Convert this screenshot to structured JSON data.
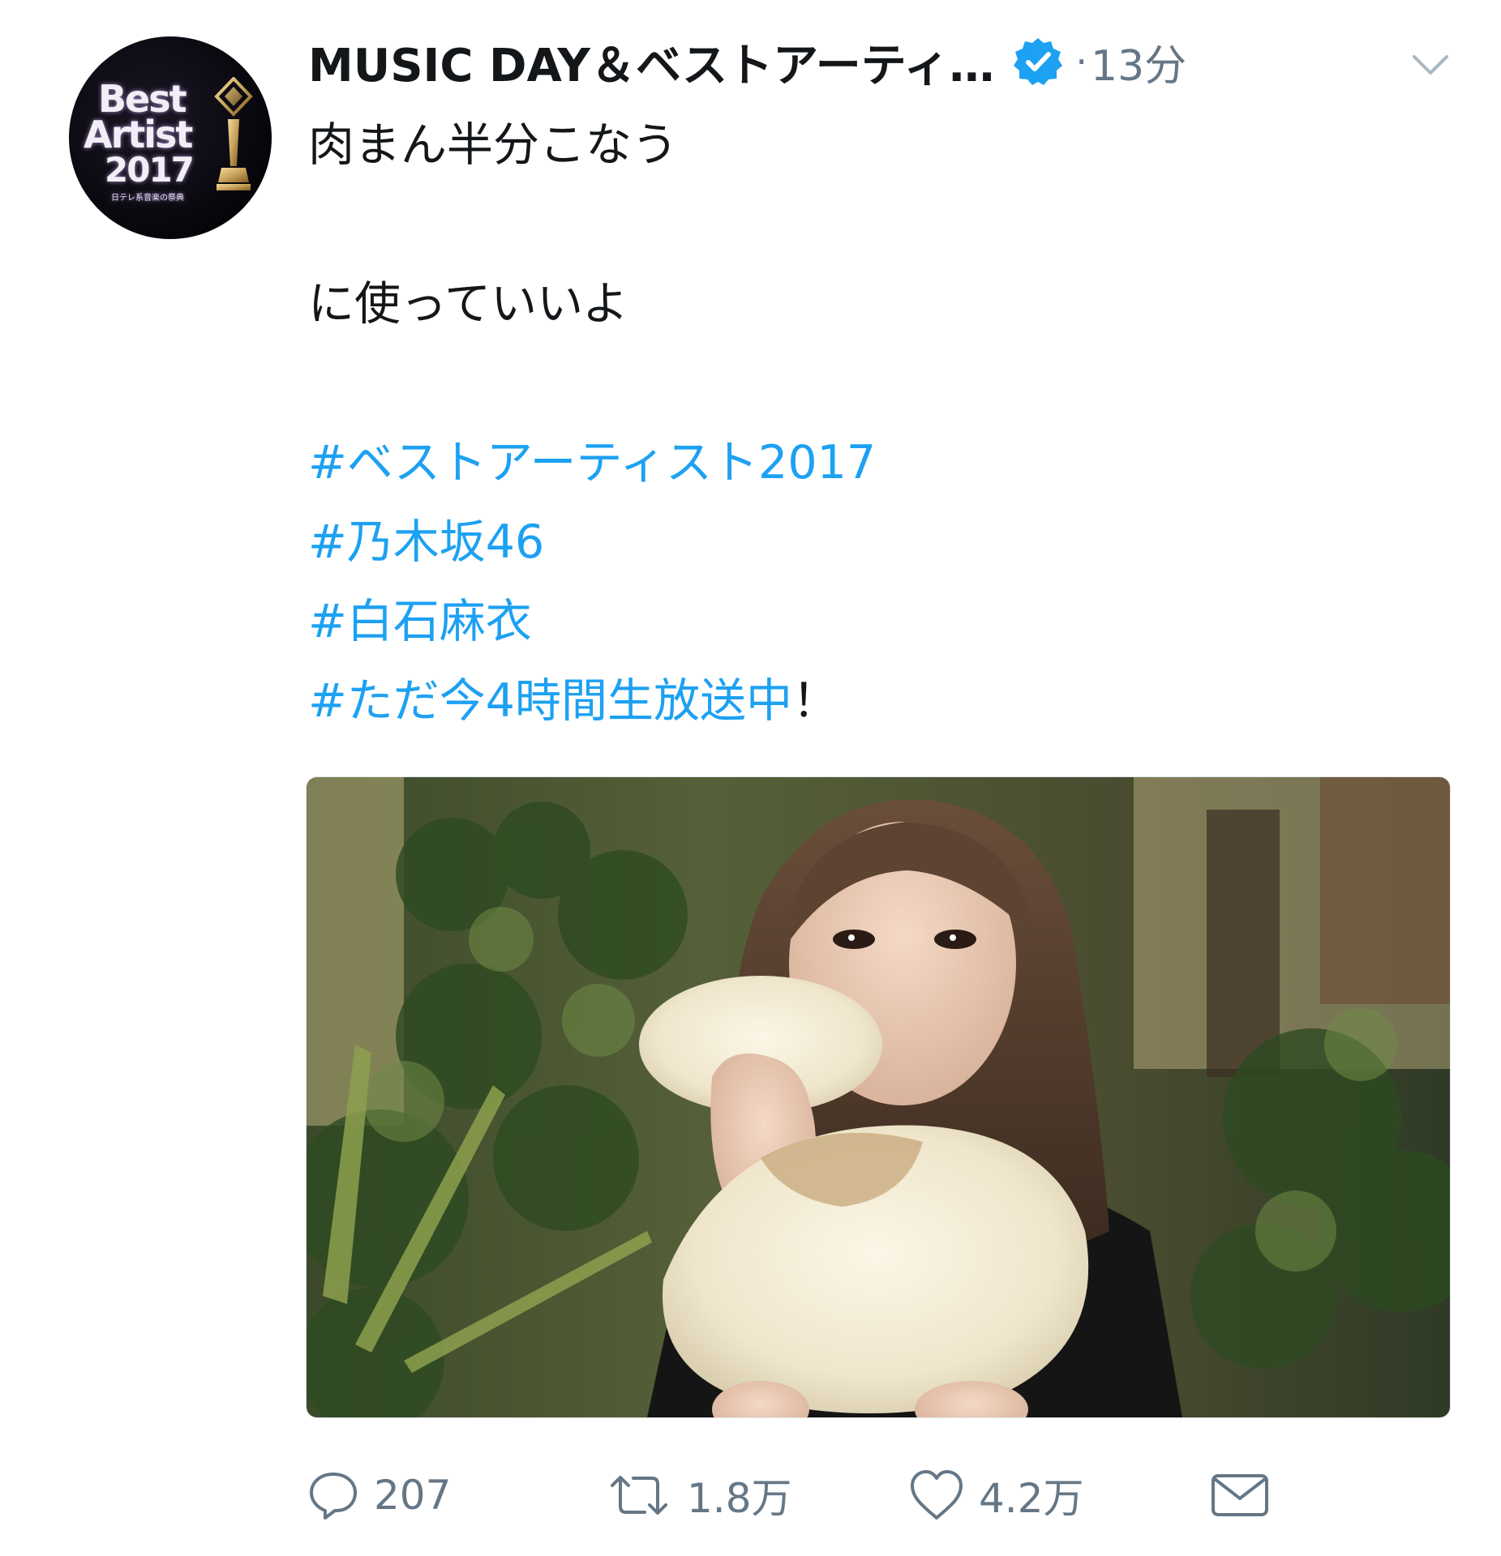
{
  "avatar": {
    "logo_lines": [
      "Best",
      "Artist",
      "2017"
    ],
    "logo_subtitle": "日テレ系音楽の祭典",
    "accent_color": "#c9a35a"
  },
  "header": {
    "display_name": "MUSIC DAY＆ベストアーティ…",
    "verified_icon": "verified-badge-icon",
    "separator": "·",
    "timestamp": "13分",
    "menu_icon": "chevron-down-icon"
  },
  "tweet": {
    "lines": [
      "肉まん半分こなう",
      "に使っていいよ"
    ],
    "hashtags": [
      "#ベストアーティスト2017",
      "#乃木坂46",
      "#白石麻衣",
      "#ただ今4時間生放送中"
    ],
    "last_hashtag_suffix": "！",
    "hashtag_color": "#1da1f2"
  },
  "media": {
    "icon": "photo-woman-eating-bun"
  },
  "actions": {
    "reply_count": "207",
    "retweet_count": "1.8万",
    "like_count": "4.2万"
  },
  "colors": {
    "text": "#14171a",
    "muted": "#657786",
    "verified": "#1da1f2"
  }
}
